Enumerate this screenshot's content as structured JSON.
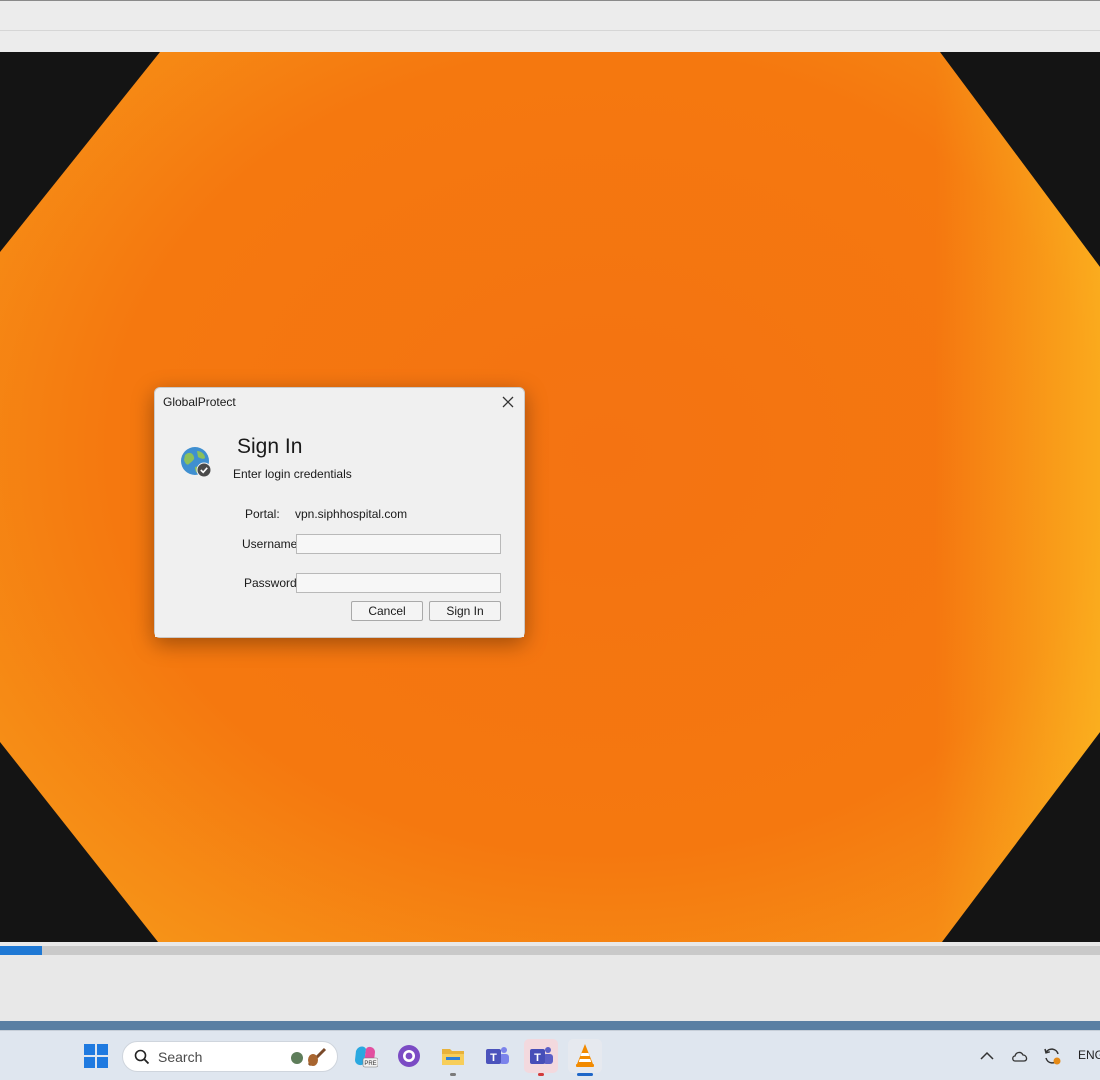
{
  "dialog": {
    "title": "GlobalProtect",
    "heading": "Sign In",
    "subheading": "Enter login credentials",
    "portal_label": "Portal:",
    "portal_value": "vpn.siphhospital.com",
    "username_label": "Username",
    "username_value": "",
    "password_label": "Password",
    "password_value": "",
    "cancel_label": "Cancel",
    "signin_label": "Sign In"
  },
  "player": {
    "progress": 0.038
  },
  "taskbar": {
    "search_placeholder": "Search",
    "icons": [
      "windows-start-icon",
      "search-icon",
      "copilot-icon",
      "github-desktop-icon",
      "file-explorer-icon",
      "teams-icon",
      "teams-work-icon",
      "vlc-icon"
    ],
    "tray_icons": [
      "chevron-up-icon",
      "onedrive-icon",
      "sync-icon"
    ],
    "language": "ENG"
  },
  "colors": {
    "accent": "#1e78d4",
    "video_orange": "#f57a12",
    "dialog_bg": "#f0f0f0"
  }
}
